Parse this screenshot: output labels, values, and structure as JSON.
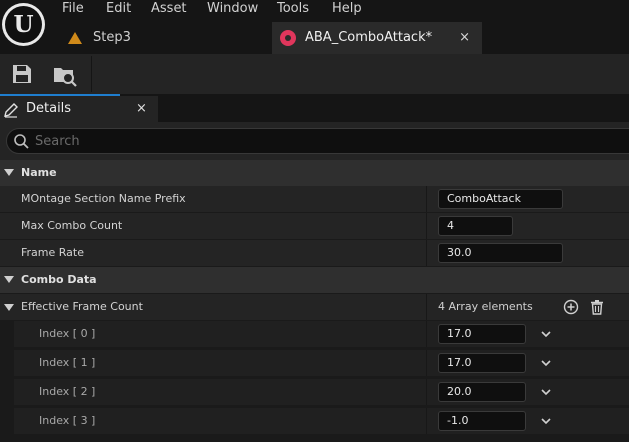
{
  "menu": {
    "items": [
      "File",
      "Edit",
      "Asset",
      "Window",
      "Tools",
      "Help"
    ],
    "logo_letter": "U"
  },
  "tabs": [
    {
      "label": "Step3",
      "icon": "level-icon"
    },
    {
      "label": "ABA_ComboAttack*",
      "icon": "anim-montage-icon",
      "close": "×"
    }
  ],
  "toolbar": {
    "buttons": [
      {
        "name": "save-icon"
      },
      {
        "name": "browse-to-asset-icon"
      }
    ]
  },
  "details_panel": {
    "tab_label": "Details",
    "close": "×",
    "search": {
      "placeholder": "Search",
      "value": ""
    }
  },
  "categories": {
    "name": {
      "label": "Name",
      "properties": [
        {
          "label": "MOntage Section Name Prefix",
          "value": "ComboAttack"
        },
        {
          "label": "Max Combo Count",
          "value": "4"
        },
        {
          "label": "Frame Rate",
          "value": "30.0"
        }
      ]
    },
    "combo_data": {
      "label": "Combo Data",
      "array": {
        "label": "Effective Frame Count",
        "count_text": "4 Array elements",
        "elements": [
          {
            "label": "Index [ 0 ]",
            "value": "17.0"
          },
          {
            "label": "Index [ 1 ]",
            "value": "17.0"
          },
          {
            "label": "Index [ 2 ]",
            "value": "20.0"
          },
          {
            "label": "Index [ 3 ]",
            "value": "-1.0"
          }
        ]
      }
    }
  },
  "colors": {
    "accent": "#1f7ecf",
    "montage_icon": "#e0365c",
    "level_icon": "#d08a1a"
  }
}
